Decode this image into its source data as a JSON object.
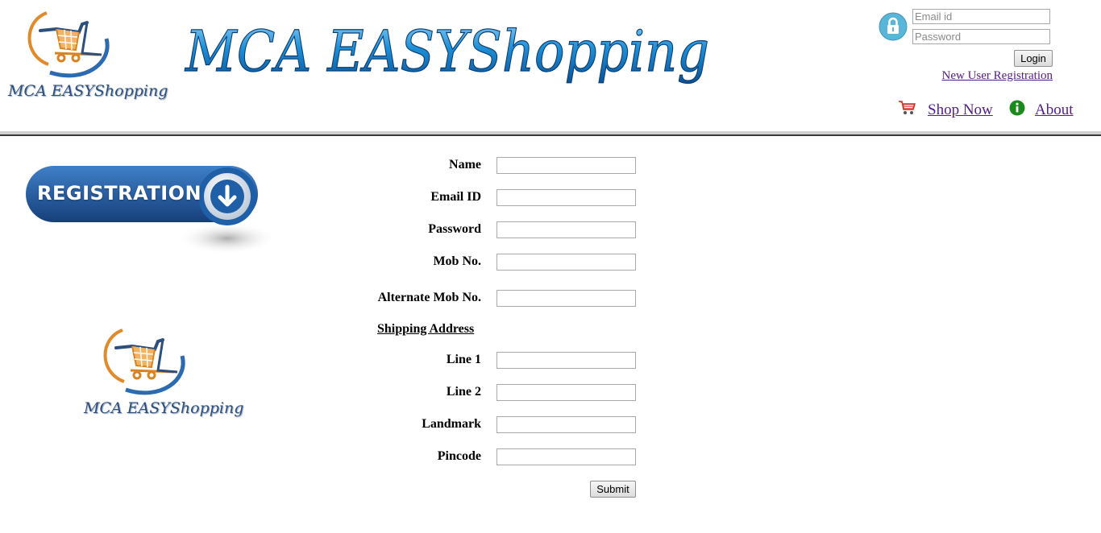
{
  "header": {
    "logo_text": "MCA EASYShopping",
    "banner_text": "MCA EASYShopping"
  },
  "login": {
    "email_placeholder": "Email id",
    "password_placeholder": "Password",
    "button_label": "Login",
    "new_user_link": "New User Registration"
  },
  "nav": {
    "shop_now": "Shop Now",
    "about": "About"
  },
  "sidebar": {
    "badge_text": "REGISTRATION",
    "logo_text": "MCA EASYShopping"
  },
  "form": {
    "name_label": "Name",
    "email_label": "Email ID",
    "password_label": "Password",
    "mob_label": "Mob No.",
    "alt_mob_label": "Alternate Mob No.",
    "shipping_heading": "Shipping Address",
    "line1_label": "Line 1",
    "line2_label": "Line 2",
    "landmark_label": "Landmark",
    "pincode_label": "Pincode",
    "submit_label": "Submit"
  },
  "colors": {
    "link": "#551a8b",
    "banner_blue": "#1e8fd6",
    "logo_navy": "#2d4f7e",
    "logo_orange": "#e08a2a",
    "badge_blue": "#1f5fa8",
    "info_green": "#1a8a1a"
  },
  "icons": {
    "lock": "lock-icon",
    "cart": "shopping-cart-icon",
    "info": "info-icon",
    "download_arrow": "arrow-down-circle-icon"
  }
}
